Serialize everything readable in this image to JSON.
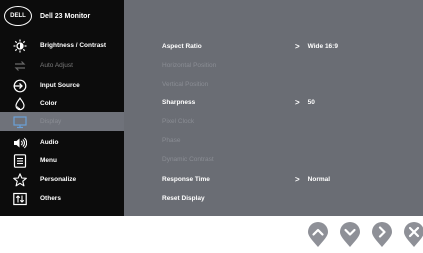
{
  "brand": {
    "logo": "DELL",
    "model": "Dell 23 Monitor"
  },
  "menu": [
    {
      "label": "Brightness / Contrast",
      "icon": "brightness-icon",
      "state": "normal"
    },
    {
      "label": "Auto Adjust",
      "icon": "auto-adjust-icon",
      "state": "disabled"
    },
    {
      "label": "Input Source",
      "icon": "input-source-icon",
      "state": "normal"
    },
    {
      "label": "Color",
      "icon": "color-icon",
      "state": "normal"
    },
    {
      "label": "Display",
      "icon": "display-icon",
      "state": "active"
    },
    {
      "label": "Audio",
      "icon": "audio-icon",
      "state": "normal"
    },
    {
      "label": "Menu",
      "icon": "menu-icon",
      "state": "normal"
    },
    {
      "label": "Personalize",
      "icon": "star-icon",
      "state": "normal"
    },
    {
      "label": "Others",
      "icon": "others-icon",
      "state": "normal"
    }
  ],
  "display_settings": [
    {
      "label": "Aspect Ratio",
      "value": "Wide 16:9",
      "state": "enabled"
    },
    {
      "label": "Horizontal Position",
      "value": "",
      "state": "disabled"
    },
    {
      "label": "Vertical Position",
      "value": "",
      "state": "disabled"
    },
    {
      "label": "Sharpness",
      "value": "50",
      "state": "enabled"
    },
    {
      "label": "Pixel Clock",
      "value": "",
      "state": "disabled"
    },
    {
      "label": "Phase",
      "value": "",
      "state": "disabled"
    },
    {
      "label": "Dynamic Contrast",
      "value": "",
      "state": "disabled"
    },
    {
      "label": "Response Time",
      "value": "Normal",
      "state": "enabled"
    },
    {
      "label": "Reset Display",
      "value": "",
      "state": "enabled"
    }
  ],
  "value_arrow": ">",
  "nav_buttons": [
    {
      "icon": "arrow-up-icon"
    },
    {
      "icon": "arrow-down-icon"
    },
    {
      "icon": "arrow-right-icon"
    },
    {
      "icon": "close-icon"
    }
  ],
  "colors": {
    "sidebar_bg": "#0c0c0c",
    "panel_bg": "#6a6d74",
    "active_item_bg": "#6f727a",
    "button_fill": "#8e9097"
  }
}
